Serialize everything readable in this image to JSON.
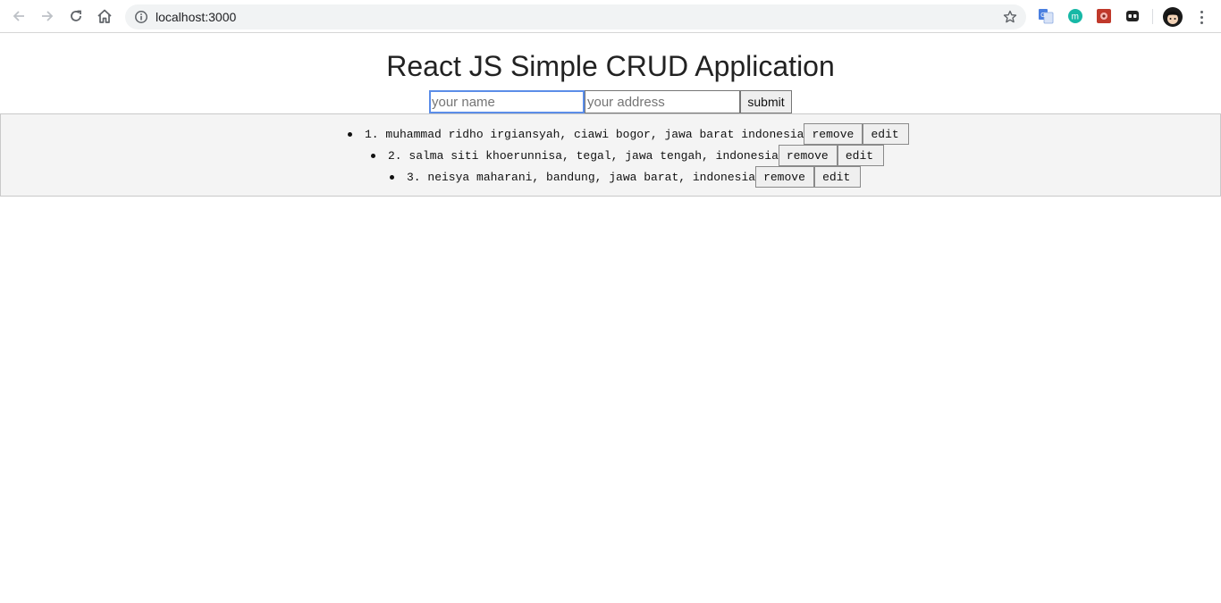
{
  "browser": {
    "url": "localhost:3000"
  },
  "page": {
    "title": "React JS Simple CRUD Application",
    "form": {
      "name_placeholder": "your name",
      "name_value": "",
      "address_placeholder": "your address",
      "address_value": "",
      "submit_label": "submit"
    },
    "items": [
      {
        "text": "1. muhammad ridho irgiansyah, ciawi bogor, jawa barat indonesia",
        "remove_label": "remove",
        "edit_label": "edit"
      },
      {
        "text": "2. salma siti khoerunnisa, tegal, jawa tengah, indonesia",
        "remove_label": "remove",
        "edit_label": "edit"
      },
      {
        "text": "3. neisya maharani, bandung, jawa barat, indonesia",
        "remove_label": "remove",
        "edit_label": "edit"
      }
    ]
  },
  "colors": {
    "panel_bg": "#f4f4f4",
    "focus_blue": "#5b8de8"
  }
}
